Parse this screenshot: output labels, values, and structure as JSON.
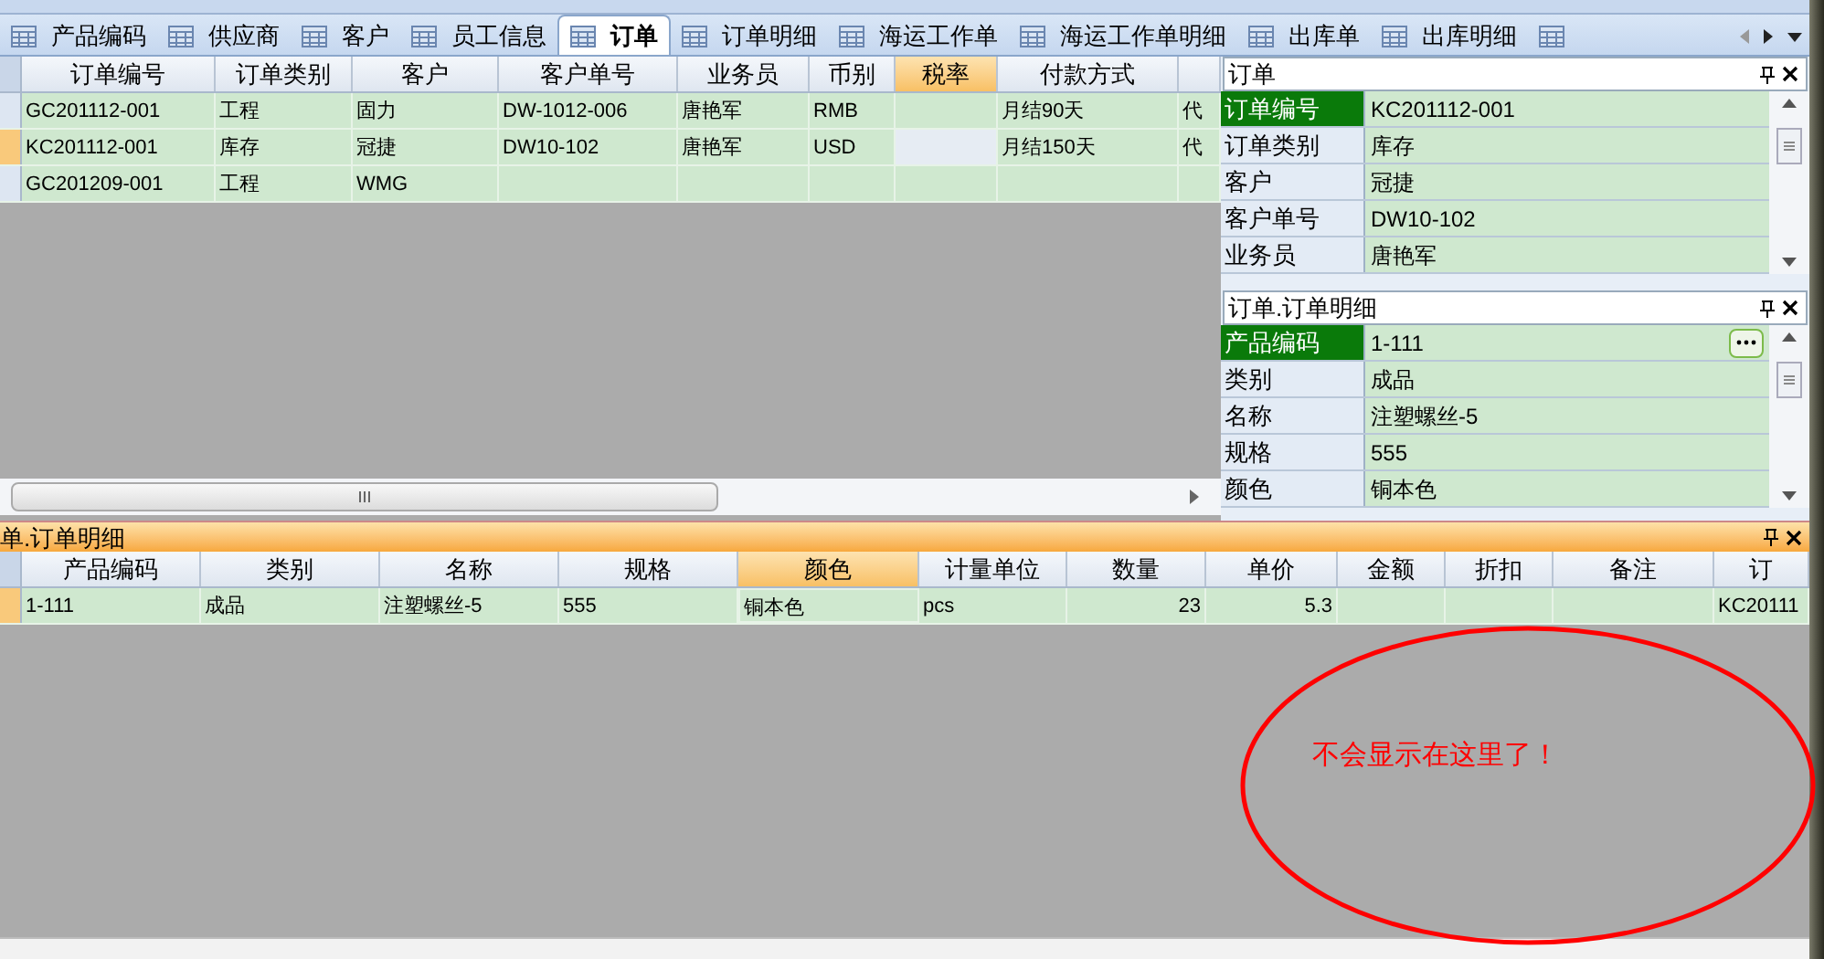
{
  "tabs": [
    {
      "label": "产品编码",
      "selected": false
    },
    {
      "label": "供应商",
      "selected": false
    },
    {
      "label": "客户",
      "selected": false
    },
    {
      "label": "员工信息",
      "selected": false
    },
    {
      "label": "订单",
      "selected": true
    },
    {
      "label": "订单明细",
      "selected": false
    },
    {
      "label": "海运工作单",
      "selected": false
    },
    {
      "label": "海运工作单明细",
      "selected": false
    },
    {
      "label": "出库单",
      "selected": false
    },
    {
      "label": "出库明细",
      "selected": false
    },
    {
      "selected": false
    }
  ],
  "orders_grid": {
    "columns": [
      {
        "label": "订单编号",
        "selected": false
      },
      {
        "label": "订单类别",
        "selected": false
      },
      {
        "label": "客户",
        "selected": false
      },
      {
        "label": "客户单号",
        "selected": false
      },
      {
        "label": "业务员",
        "selected": false
      },
      {
        "label": "币别",
        "selected": false
      },
      {
        "label": "税率",
        "selected": true
      },
      {
        "label": "付款方式",
        "selected": false
      },
      {
        "selected": false
      }
    ],
    "rows": [
      {
        "selected": false,
        "cells": [
          "GC201112-001",
          "工程",
          "固力",
          "DW-1012-006",
          "唐艳军",
          "RMB",
          "",
          "月结90天",
          "代"
        ]
      },
      {
        "selected": true,
        "cells": [
          "KC201112-001",
          "库存",
          "冠捷",
          "DW10-102",
          "唐艳军",
          "USD",
          "",
          "月结150天",
          "代"
        ]
      },
      {
        "selected": false,
        "cells": [
          "GC201209-001",
          "工程",
          "WMG",
          "",
          "",
          "",
          "",
          "",
          ""
        ]
      }
    ]
  },
  "order_panel": {
    "title": "订单",
    "rows": [
      {
        "label": "订单编号",
        "value": "KC201112-001",
        "selected": true
      },
      {
        "label": "订单类别",
        "value": "库存",
        "selected": false
      },
      {
        "label": "客户",
        "value": "冠捷",
        "selected": false
      },
      {
        "label": "客户单号",
        "value": "DW10-102",
        "selected": false
      },
      {
        "label": "业务员",
        "value": "唐艳军",
        "selected": false
      }
    ]
  },
  "detail_panel": {
    "title": "订单.订单明细",
    "rows": [
      {
        "label": "产品编码",
        "value": "1-111",
        "selected": true
      },
      {
        "label": "类别",
        "value": "成品",
        "selected": false
      },
      {
        "label": "名称",
        "value": "注塑螺丝-5",
        "selected": false
      },
      {
        "label": "规格",
        "value": "555",
        "selected": false
      },
      {
        "label": "颜色",
        "value": "铜本色",
        "selected": false
      }
    ]
  },
  "detail_grid": {
    "title": "单.订单明细",
    "columns": [
      {
        "label": "产品编码",
        "selected": false
      },
      {
        "label": "类别",
        "selected": false
      },
      {
        "label": "名称",
        "selected": false
      },
      {
        "label": "规格",
        "selected": false
      },
      {
        "label": "颜色",
        "selected": true
      },
      {
        "label": "计量单位",
        "selected": false
      },
      {
        "label": "数量",
        "selected": false
      },
      {
        "label": "单价",
        "selected": false
      },
      {
        "label": "金额",
        "selected": false
      },
      {
        "label": "折扣",
        "selected": false
      },
      {
        "label": "备注",
        "selected": false
      },
      {
        "label": "订",
        "selected": false
      }
    ],
    "rows": [
      {
        "selected": true,
        "cells": [
          "1-111",
          "成品",
          "注塑螺丝-5",
          "555",
          "铜本色",
          "pcs",
          "23",
          "5.3",
          "",
          "",
          "",
          "KC20111"
        ]
      }
    ]
  },
  "annotation": "不会显示在这里了！"
}
